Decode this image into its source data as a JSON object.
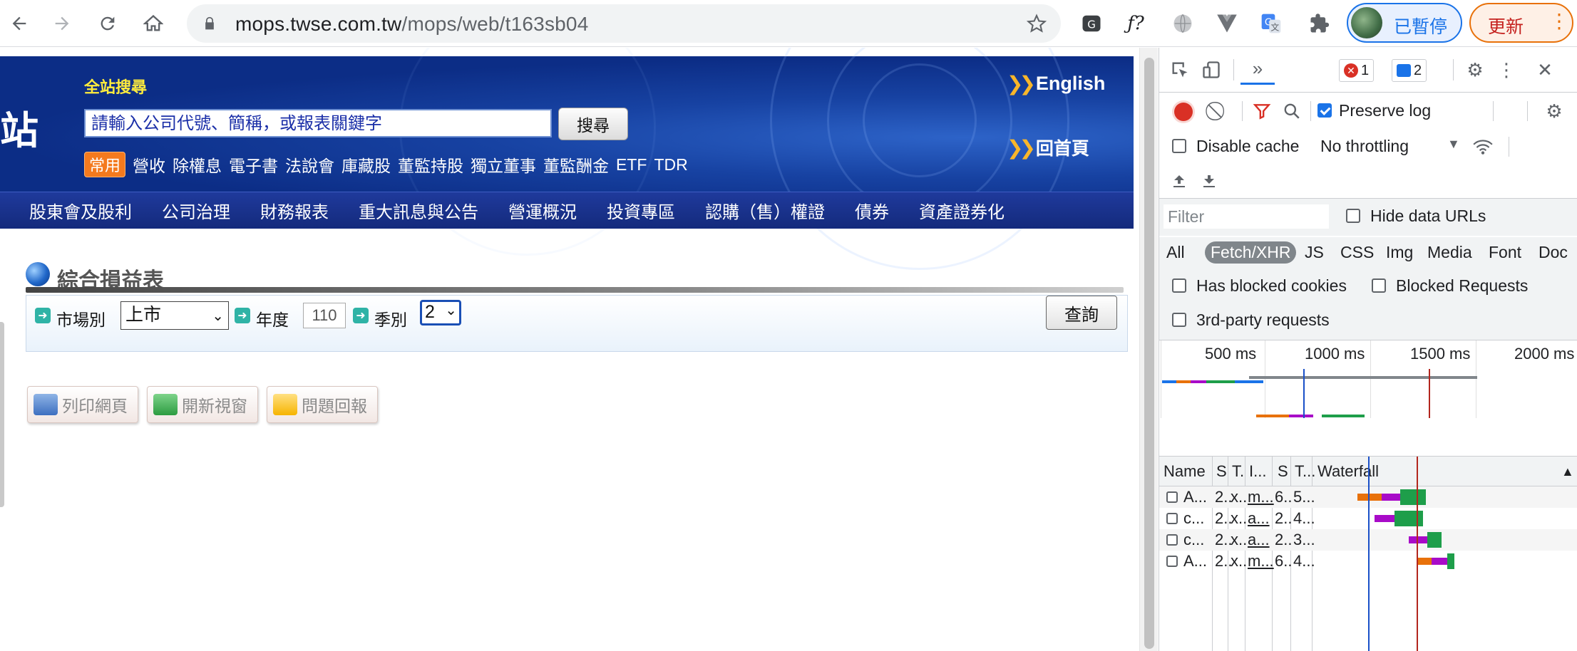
{
  "browser": {
    "url_host": "mops.twse.com.tw",
    "url_path": "/mops/web/t163sb04",
    "profile_label": "已暫停",
    "update_label": "更新"
  },
  "site": {
    "search_label": "全站搜尋",
    "search_placeholder": "請輸入公司代號、簡稱，或報表關鍵字",
    "search_button": "搜尋",
    "common_badge": "常用",
    "quick_links": [
      "營收",
      "除權息",
      "電子書",
      "法說會",
      "庫藏股",
      "董監持股",
      "獨立董事",
      "董監酬金",
      "ETF",
      "TDR"
    ],
    "english_link": "English",
    "home_link": "回首頁",
    "nav_items": [
      "股東會及股利",
      "公司治理",
      "財務報表",
      "重大訊息與公告",
      "營運概況",
      "投資專區",
      "認購（售）權證",
      "債券",
      "資產證券化"
    ]
  },
  "report": {
    "title": "綜合損益表",
    "market_label": "市場別",
    "market_value": "上市",
    "year_label": "年度",
    "year_value": "110",
    "season_label": "季別",
    "season_value": "2",
    "query_button": "查詢",
    "actions": [
      "列印網頁",
      "開新視窗",
      "問題回報"
    ]
  },
  "devtools": {
    "error_count": "1",
    "message_count": "2",
    "preserve_log_label": "Preserve log",
    "preserve_log_checked": true,
    "disable_cache_label": "Disable cache",
    "throttling_value": "No throttling",
    "filter_placeholder": "Filter",
    "hide_data_urls_label": "Hide data URLs",
    "type_filters": [
      "All",
      "Fetch/XHR",
      "JS",
      "CSS",
      "Img",
      "Media",
      "Font",
      "Doc"
    ],
    "selected_type_filter": "Fetch/XHR",
    "has_blocked_cookies_label": "Has blocked cookies",
    "blocked_requests_label": "Blocked Requests",
    "third_party_label": "3rd-party requests",
    "timeline_ticks": [
      "500 ms",
      "1000 ms",
      "1500 ms",
      "2000 ms"
    ],
    "columns": [
      "Name",
      "S",
      "T.",
      "I...",
      "S",
      "T...",
      "Waterfall"
    ],
    "requests": [
      {
        "name": "A...",
        "status": "2..",
        "type": "x..",
        "initiator": "m...",
        "size": "6..",
        "time": "5..."
      },
      {
        "name": "c...",
        "status": "2..",
        "type": "x..",
        "initiator": "a...",
        "size": "2..",
        "time": "4..."
      },
      {
        "name": "c...",
        "status": "2..",
        "type": "x..",
        "initiator": "a...",
        "size": "2..",
        "time": "3..."
      },
      {
        "name": "A...",
        "status": "2..",
        "type": "x..",
        "initiator": "m...",
        "size": "6..",
        "time": "4..."
      }
    ]
  },
  "colors": {
    "banner_blue": "#0c2d86",
    "nav_blue": "#1a3590",
    "accent_orange": "#f47a1e",
    "devtools_blue": "#1a73e8"
  }
}
